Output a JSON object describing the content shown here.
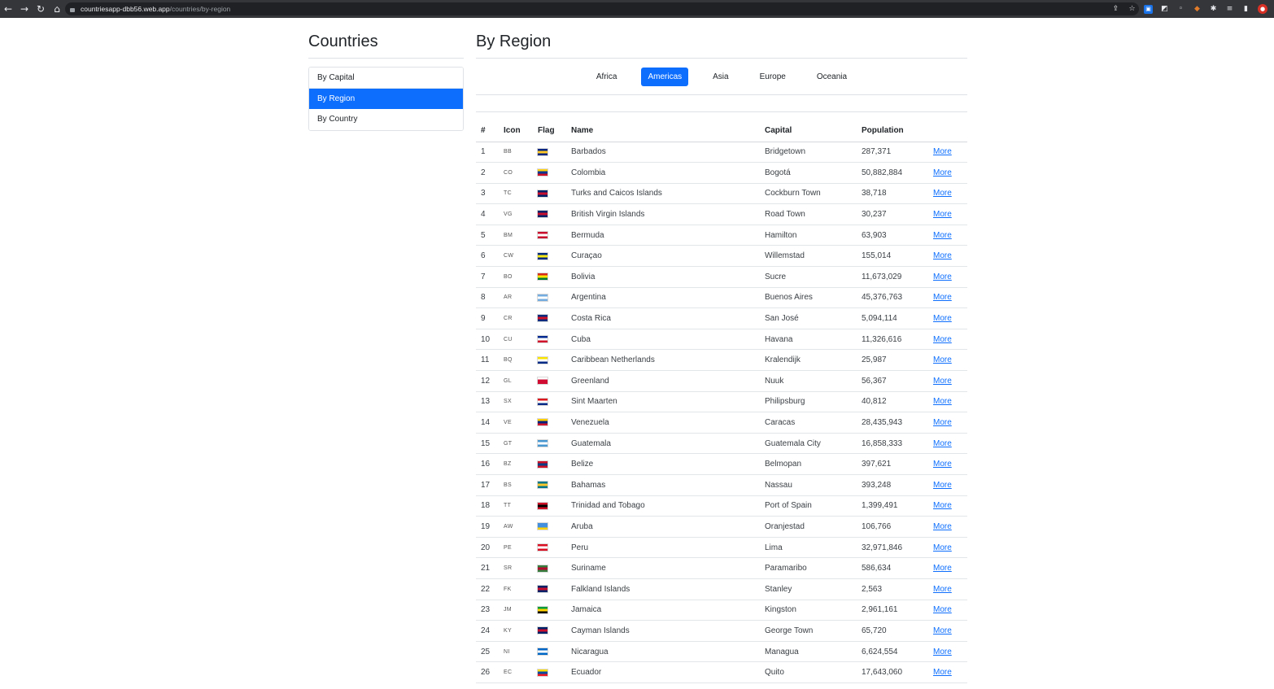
{
  "browser": {
    "url_host": "countriesapp-dbb56.web.app",
    "url_path": "/countries/by-region"
  },
  "sidebar": {
    "title": "Countries",
    "items": [
      {
        "label": "By Capital",
        "active": false
      },
      {
        "label": "By Region",
        "active": true
      },
      {
        "label": "By Country",
        "active": false
      }
    ]
  },
  "main": {
    "title": "By Region",
    "regions": [
      {
        "label": "Africa",
        "active": false
      },
      {
        "label": "Americas",
        "active": true
      },
      {
        "label": "Asia",
        "active": false
      },
      {
        "label": "Europe",
        "active": false
      },
      {
        "label": "Oceania",
        "active": false
      }
    ],
    "table": {
      "headers": [
        "#",
        "Icon",
        "Flag",
        "Name",
        "Capital",
        "Population",
        ""
      ],
      "more_label": "More",
      "rows": [
        {
          "n": "1",
          "code": "BB",
          "name": "Barbados",
          "capital": "Bridgetown",
          "population": "287,371",
          "flag": [
            "#00267f",
            "#ffc726",
            "#00267f"
          ]
        },
        {
          "n": "2",
          "code": "CO",
          "name": "Colombia",
          "capital": "Bogotá",
          "population": "50,882,884",
          "flag": [
            "#fcd116",
            "#003893",
            "#ce1126"
          ]
        },
        {
          "n": "3",
          "code": "TC",
          "name": "Turks and Caicos Islands",
          "capital": "Cockburn Town",
          "population": "38,718",
          "flag": [
            "#012169",
            "#c8102e",
            "#012169"
          ]
        },
        {
          "n": "4",
          "code": "VG",
          "name": "British Virgin Islands",
          "capital": "Road Town",
          "population": "30,237",
          "flag": [
            "#012169",
            "#c8102e",
            "#012169"
          ]
        },
        {
          "n": "5",
          "code": "BM",
          "name": "Bermuda",
          "capital": "Hamilton",
          "population": "63,903",
          "flag": [
            "#c8102e",
            "#ffffff",
            "#c8102e"
          ]
        },
        {
          "n": "6",
          "code": "CW",
          "name": "Curaçao",
          "capital": "Willemstad",
          "population": "155,014",
          "flag": [
            "#002b7f",
            "#f9e814",
            "#002b7f"
          ]
        },
        {
          "n": "7",
          "code": "BO",
          "name": "Bolivia",
          "capital": "Sucre",
          "population": "11,673,029",
          "flag": [
            "#d52b1e",
            "#f9e300",
            "#007934"
          ]
        },
        {
          "n": "8",
          "code": "AR",
          "name": "Argentina",
          "capital": "Buenos Aires",
          "population": "45,376,763",
          "flag": [
            "#74acdf",
            "#ffffff",
            "#74acdf"
          ]
        },
        {
          "n": "9",
          "code": "CR",
          "name": "Costa Rica",
          "capital": "San José",
          "population": "5,094,114",
          "flag": [
            "#002b7f",
            "#ce1126",
            "#002b7f"
          ]
        },
        {
          "n": "10",
          "code": "CU",
          "name": "Cuba",
          "capital": "Havana",
          "population": "11,326,616",
          "flag": [
            "#002a8f",
            "#ffffff",
            "#cf142b"
          ]
        },
        {
          "n": "11",
          "code": "BQ",
          "name": "Caribbean Netherlands",
          "capital": "Kralendijk",
          "population": "25,987",
          "flag": [
            "#f9e300",
            "#ffffff",
            "#012a87"
          ]
        },
        {
          "n": "12",
          "code": "GL",
          "name": "Greenland",
          "capital": "Nuuk",
          "population": "56,367",
          "flag": [
            "#ffffff",
            "#d00c33",
            "#d00c33"
          ]
        },
        {
          "n": "13",
          "code": "SX",
          "name": "Sint Maarten",
          "capital": "Philipsburg",
          "population": "40,812",
          "flag": [
            "#dc171d",
            "#ffffff",
            "#012a87"
          ]
        },
        {
          "n": "14",
          "code": "VE",
          "name": "Venezuela",
          "capital": "Caracas",
          "population": "28,435,943",
          "flag": [
            "#ffcc00",
            "#00247d",
            "#cf142b"
          ]
        },
        {
          "n": "15",
          "code": "GT",
          "name": "Guatemala",
          "capital": "Guatemala City",
          "population": "16,858,333",
          "flag": [
            "#4997d0",
            "#ffffff",
            "#4997d0"
          ]
        },
        {
          "n": "16",
          "code": "BZ",
          "name": "Belize",
          "capital": "Belmopan",
          "population": "397,621",
          "flag": [
            "#ce1126",
            "#003f87",
            "#ce1126"
          ]
        },
        {
          "n": "17",
          "code": "BS",
          "name": "Bahamas",
          "capital": "Nassau",
          "population": "393,248",
          "flag": [
            "#00778b",
            "#ffc72c",
            "#00778b"
          ]
        },
        {
          "n": "18",
          "code": "TT",
          "name": "Trinidad and Tobago",
          "capital": "Port of Spain",
          "population": "1,399,491",
          "flag": [
            "#ce1126",
            "#000000",
            "#ce1126"
          ]
        },
        {
          "n": "19",
          "code": "AW",
          "name": "Aruba",
          "capital": "Oranjestad",
          "population": "106,766",
          "flag": [
            "#418fde",
            "#418fde",
            "#ffd100"
          ]
        },
        {
          "n": "20",
          "code": "PE",
          "name": "Peru",
          "capital": "Lima",
          "population": "32,971,846",
          "flag": [
            "#d91023",
            "#ffffff",
            "#d91023"
          ]
        },
        {
          "n": "21",
          "code": "SR",
          "name": "Suriname",
          "capital": "Paramaribo",
          "population": "586,634",
          "flag": [
            "#377e3f",
            "#b40a2d",
            "#377e3f"
          ]
        },
        {
          "n": "22",
          "code": "FK",
          "name": "Falkland Islands",
          "capital": "Stanley",
          "population": "2,563",
          "flag": [
            "#012169",
            "#c8102e",
            "#012169"
          ]
        },
        {
          "n": "23",
          "code": "JM",
          "name": "Jamaica",
          "capital": "Kingston",
          "population": "2,961,161",
          "flag": [
            "#009b3a",
            "#fed100",
            "#000000"
          ]
        },
        {
          "n": "24",
          "code": "KY",
          "name": "Cayman Islands",
          "capital": "George Town",
          "population": "65,720",
          "flag": [
            "#012169",
            "#c8102e",
            "#012169"
          ]
        },
        {
          "n": "25",
          "code": "NI",
          "name": "Nicaragua",
          "capital": "Managua",
          "population": "6,624,554",
          "flag": [
            "#0067c6",
            "#ffffff",
            "#0067c6"
          ]
        },
        {
          "n": "26",
          "code": "EC",
          "name": "Ecuador",
          "capital": "Quito",
          "population": "17,643,060",
          "flag": [
            "#ffdd00",
            "#034ea2",
            "#ed1c24"
          ]
        }
      ]
    }
  },
  "colors": {
    "accent": "#0d6efd",
    "chrome": "#35363a"
  }
}
